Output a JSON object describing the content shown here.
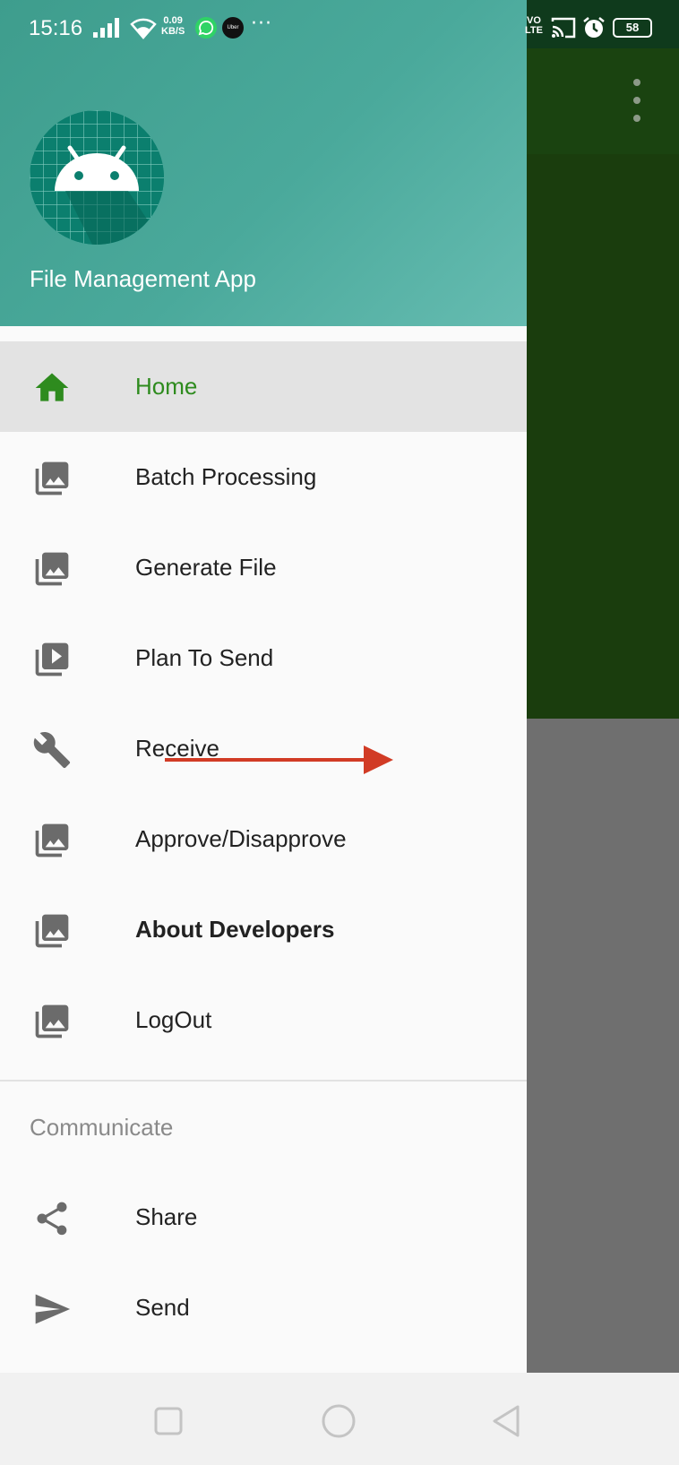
{
  "status_bar": {
    "time": "15:16",
    "net_speed_value": "0.09",
    "net_speed_unit": "KB/S",
    "volte_top": "VO",
    "volte_bottom": "LTE",
    "battery": "58",
    "uber_text": "Uber"
  },
  "drawer": {
    "header": {
      "app_title": "File Management App",
      "logo_icon": "android-icon"
    },
    "items": [
      {
        "label": "Home",
        "icon": "home-icon",
        "selected": true
      },
      {
        "label": "Batch Processing",
        "icon": "photo-library-icon"
      },
      {
        "label": "Generate File",
        "icon": "photo-library-icon"
      },
      {
        "label": "Plan To Send",
        "icon": "video-library-icon"
      },
      {
        "label": "Receive",
        "icon": "wrench-icon"
      },
      {
        "label": "Approve/Disapprove",
        "icon": "photo-library-icon"
      },
      {
        "label": "About Developers",
        "icon": "photo-library-icon",
        "bold": true
      },
      {
        "label": "LogOut",
        "icon": "photo-library-icon"
      }
    ],
    "section": {
      "title": "Communicate",
      "items": [
        {
          "label": "Share",
          "icon": "share-icon"
        },
        {
          "label": "Send",
          "icon": "send-icon"
        }
      ]
    }
  },
  "colors": {
    "header_gradient_start": "#3e9d8d",
    "header_gradient_end": "#66bcb1",
    "selected_accent": "#2e8b1e",
    "annotation_arrow": "#d13b25",
    "background_app_toolbar": "#1a4310"
  }
}
